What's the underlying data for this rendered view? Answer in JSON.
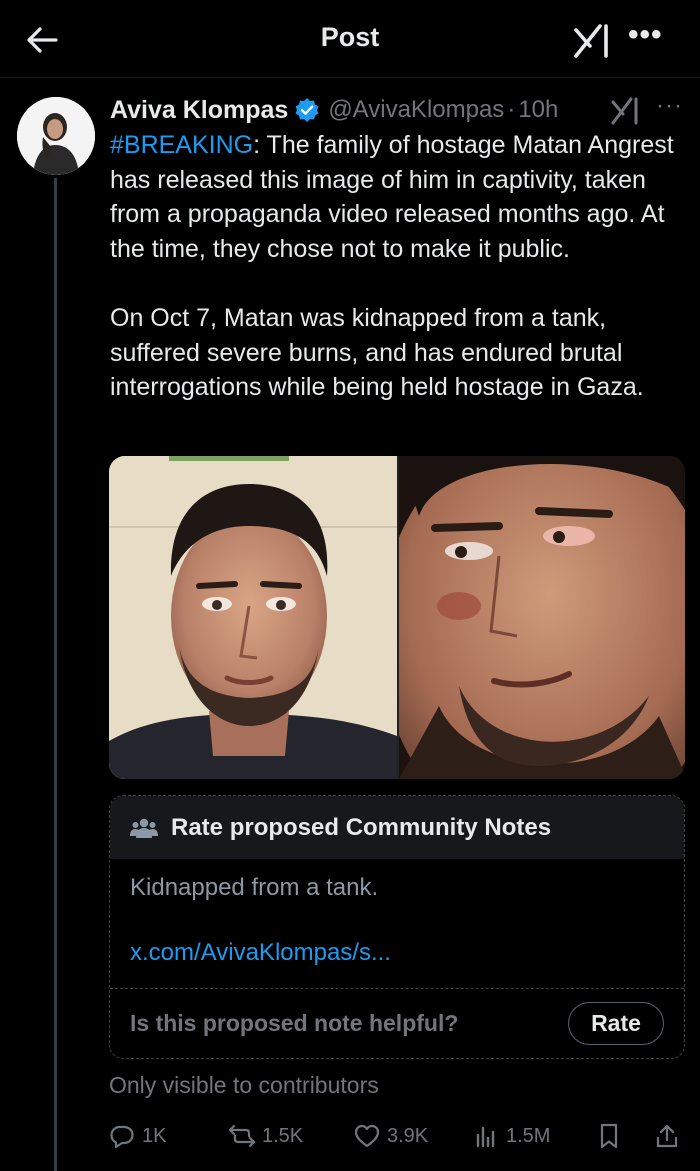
{
  "header": {
    "title": "Post",
    "back_icon": "arrow-left-icon",
    "grok_icon": "grok-icon",
    "more_icon": "more-icon",
    "more_glyph": "•••"
  },
  "post": {
    "author": {
      "name": "Aviva Klompas",
      "handle": "@AvivaKlompas",
      "time_sep": "·",
      "time": "10h",
      "verified_color": "#1d9bf0"
    },
    "more_glyph": "···",
    "hashtag": "#BREAKING",
    "text_1": ": The family of hostage Matan Angrest has released this image of him in captivity, taken from a propaganda video released months ago. At the time, they chose not to make it public.",
    "text_2": "On Oct 7, Matan was kidnapped from a tank, suffered severe burns, and has endured brutal interrogations while being held hostage in Gaza."
  },
  "community_note": {
    "title": "Rate proposed Community Notes",
    "body": "Kidnapped from a tank.",
    "link": "x.com/AvivaKlompas/s...",
    "question": "Is this proposed note helpful?",
    "rate_label": "Rate"
  },
  "visibility_note": "Only visible to contributors",
  "actions": {
    "replies": "1K",
    "reposts": "1.5K",
    "likes": "3.9K",
    "views": "1.5M"
  },
  "colors": {
    "accent": "#1d9bf0",
    "muted": "#71767b",
    "text": "#e7e9ea",
    "background": "#000000"
  }
}
